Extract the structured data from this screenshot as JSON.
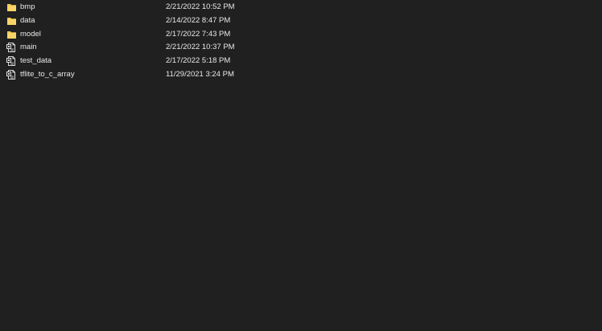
{
  "files": [
    {
      "name": "bmp",
      "date": "2/21/2022 10:52 PM",
      "icon": "folder-icon"
    },
    {
      "name": "data",
      "date": "2/14/2022 8:47 PM",
      "icon": "folder-icon"
    },
    {
      "name": "model",
      "date": "2/17/2022 7:43 PM",
      "icon": "folder-icon"
    },
    {
      "name": "main",
      "date": "2/21/2022 10:37 PM",
      "icon": "python-file-icon"
    },
    {
      "name": "test_data",
      "date": "2/17/2022 5:18 PM",
      "icon": "python-file-icon"
    },
    {
      "name": "tflite_to_c_array",
      "date": "11/29/2021 3:24 PM",
      "icon": "python-file-icon"
    }
  ],
  "colors": {
    "background": "#202020",
    "text": "#e8e8e8",
    "folder": "#f3c84a"
  }
}
